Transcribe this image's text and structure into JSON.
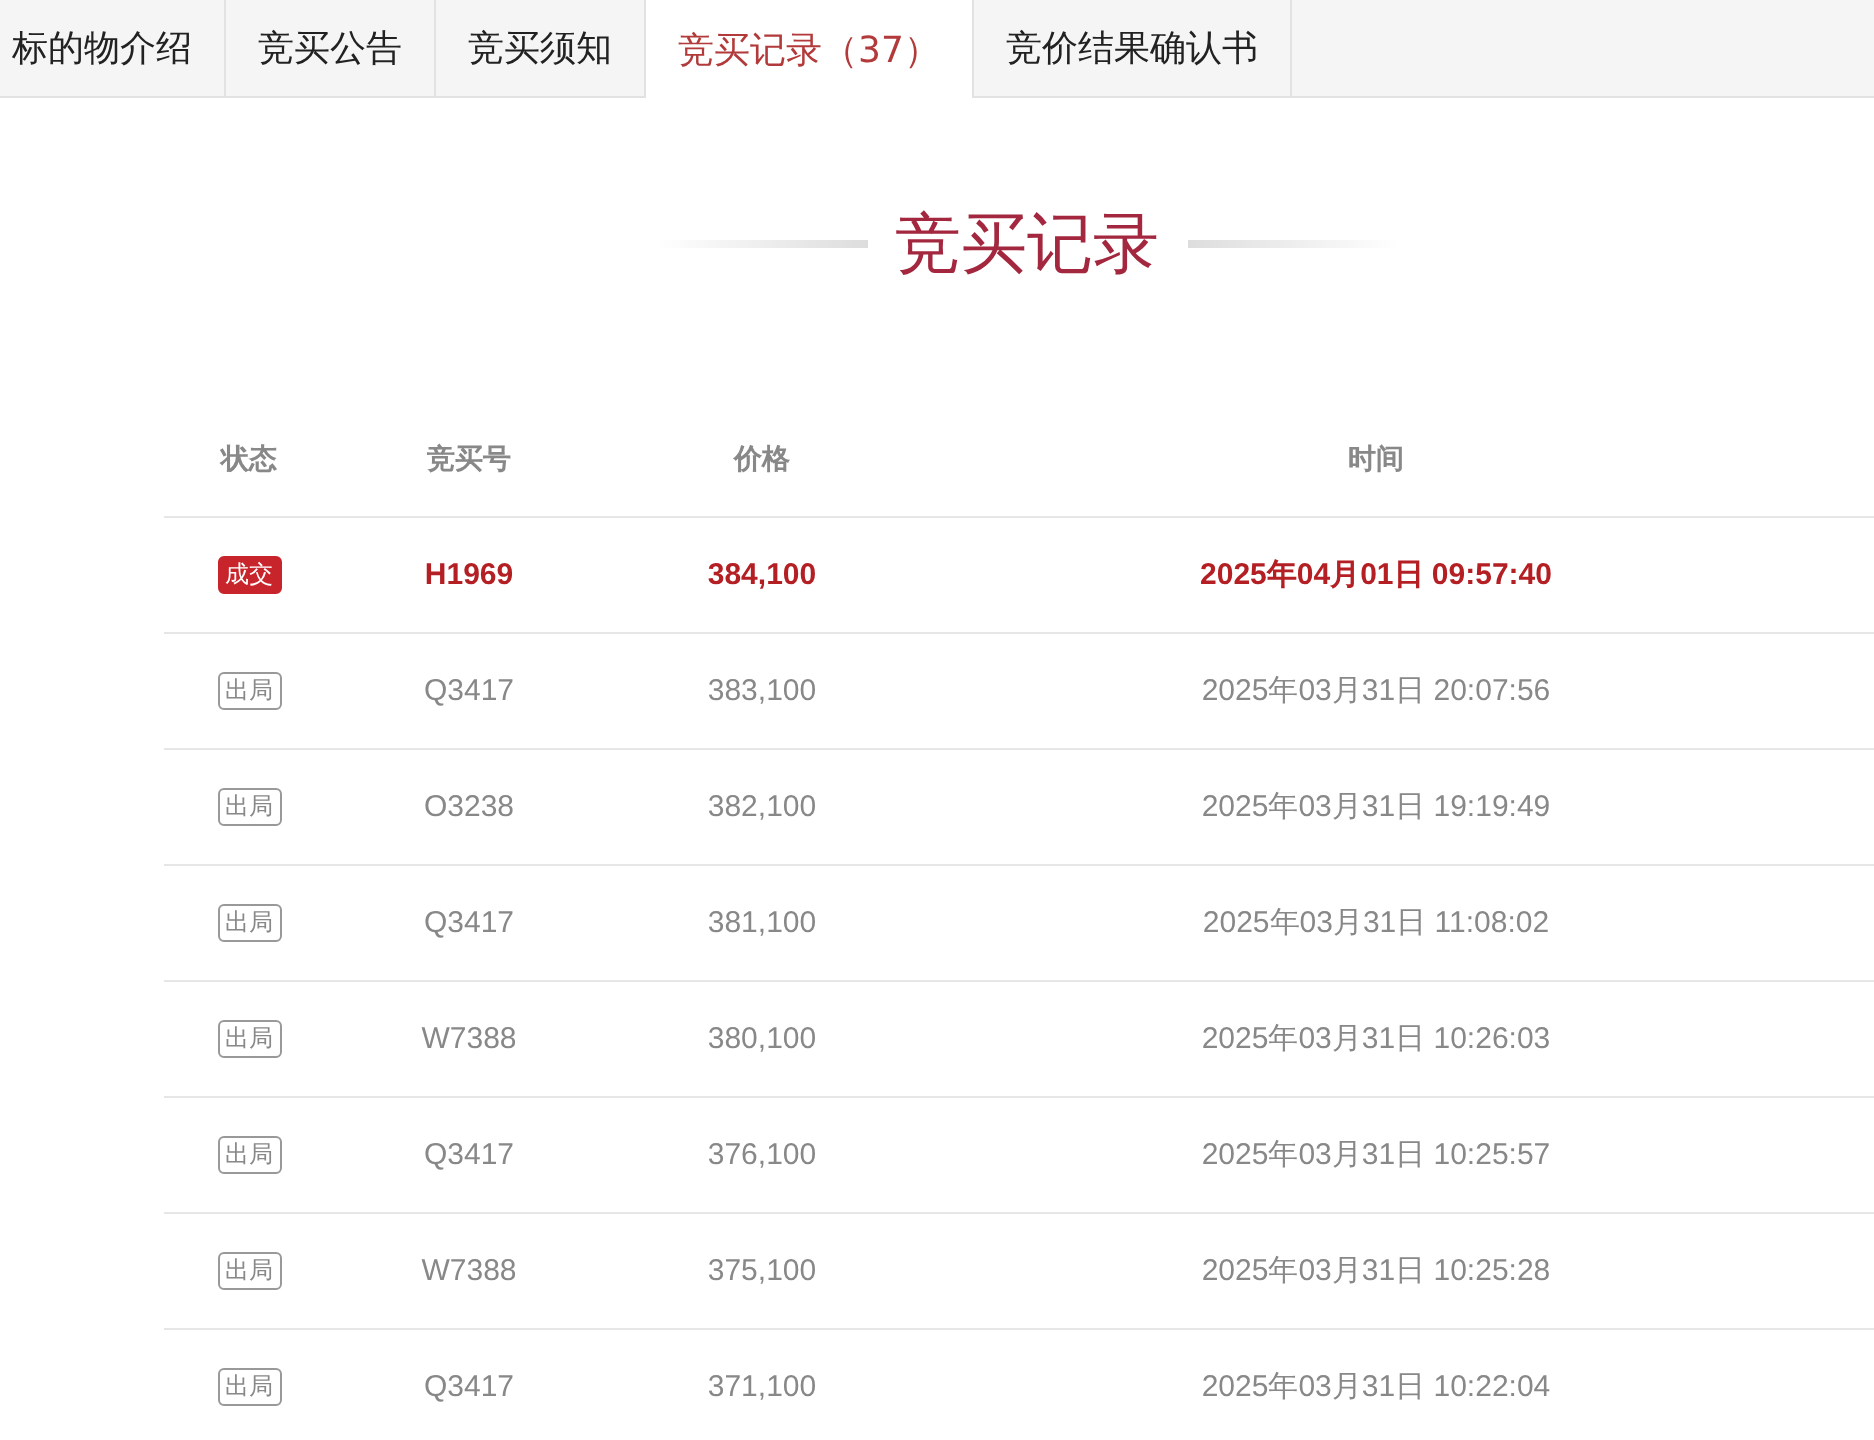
{
  "tabs": [
    {
      "label": "标的物介绍",
      "selected": false
    },
    {
      "label": "竞买公告",
      "selected": false
    },
    {
      "label": "竞买须知",
      "selected": false
    },
    {
      "label": "竞买记录（37）",
      "selected": true
    },
    {
      "label": "竞价结果确认书",
      "selected": false
    }
  ],
  "section_title": "竞买记录",
  "table": {
    "columns": [
      "状态",
      "竞买号",
      "价格",
      "时间"
    ],
    "rows": [
      {
        "status": {
          "kind": "deal",
          "label": "成交"
        },
        "bidder": "H1969",
        "price": "384,100",
        "time": "2025年04月01日 09:57:40"
      },
      {
        "status": {
          "kind": "out",
          "label": "出局"
        },
        "bidder": "Q3417",
        "price": "383,100",
        "time": "2025年03月31日 20:07:56"
      },
      {
        "status": {
          "kind": "out",
          "label": "出局"
        },
        "bidder": "O3238",
        "price": "382,100",
        "time": "2025年03月31日 19:19:49"
      },
      {
        "status": {
          "kind": "out",
          "label": "出局"
        },
        "bidder": "Q3417",
        "price": "381,100",
        "time": "2025年03月31日 11:08:02"
      },
      {
        "status": {
          "kind": "out",
          "label": "出局"
        },
        "bidder": "W7388",
        "price": "380,100",
        "time": "2025年03月31日 10:26:03"
      },
      {
        "status": {
          "kind": "out",
          "label": "出局"
        },
        "bidder": "Q3417",
        "price": "376,100",
        "time": "2025年03月31日 10:25:57"
      },
      {
        "status": {
          "kind": "out",
          "label": "出局"
        },
        "bidder": "W7388",
        "price": "375,100",
        "time": "2025年03月31日 10:25:28"
      },
      {
        "status": {
          "kind": "out",
          "label": "出局"
        },
        "bidder": "Q3417",
        "price": "371,100",
        "time": "2025年03月31日 10:22:04"
      }
    ]
  }
}
